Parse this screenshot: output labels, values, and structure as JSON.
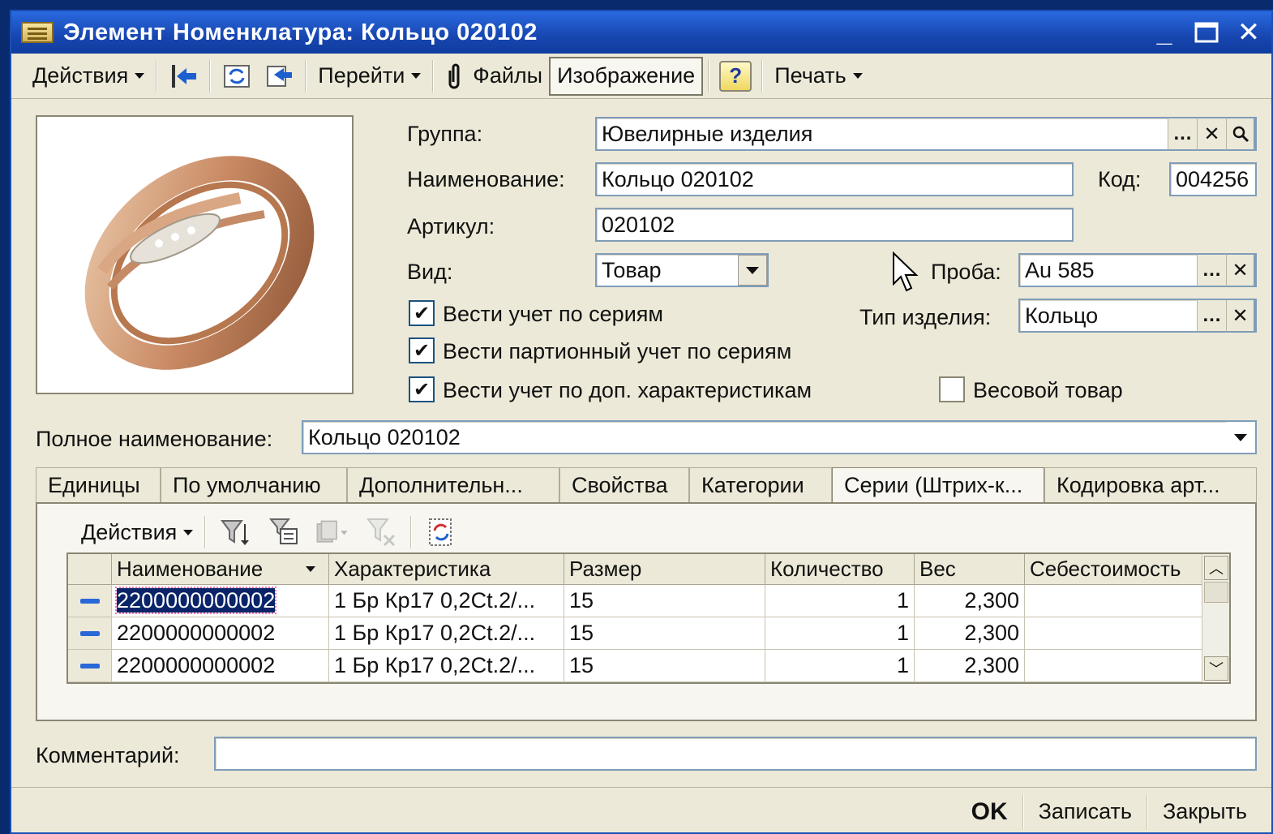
{
  "window": {
    "title": "Элемент Номенклатура: Кольцо 020102"
  },
  "toolbar": {
    "actions_label": "Действия",
    "goto_label": "Перейти",
    "files_label": "Файлы",
    "image_label": "Изображение",
    "help_label": "?",
    "print_label": "Печать"
  },
  "form": {
    "group_label": "Группа:",
    "group_value": "Ювелирные изделия",
    "name_label": "Наименование:",
    "name_value": "Кольцо 020102",
    "code_label": "Код:",
    "code_value": "004256",
    "article_label": "Артикул:",
    "article_value": "020102",
    "kind_label": "Вид:",
    "kind_value": "Товар",
    "probe_label": "Проба:",
    "probe_value": "Au 585",
    "product_type_label": "Тип изделия:",
    "product_type_value": "Кольцо",
    "check_series_label": "Вести учет по сериям",
    "check_series_checked": true,
    "check_batch_label": "Вести партионный учет по сериям",
    "check_batch_checked": true,
    "check_extra_label": "Вести учет по доп.  характеристикам",
    "check_extra_checked": true,
    "weight_label": "Весовой товар",
    "weight_checked": false,
    "full_name_label": "Полное наименование:",
    "full_name_value": "Кольцо 020102",
    "comment_label": "Комментарий:",
    "comment_value": ""
  },
  "tabs": [
    {
      "label": "Единицы",
      "active": false
    },
    {
      "label": "По умолчанию",
      "active": false
    },
    {
      "label": "Дополнительн...",
      "active": false
    },
    {
      "label": "Свойства",
      "active": false
    },
    {
      "label": "Категории",
      "active": false
    },
    {
      "label": "Серии (Штрих-к...",
      "active": true
    },
    {
      "label": "Кодировка арт...",
      "active": false
    }
  ],
  "panel": {
    "actions_label": "Действия"
  },
  "grid": {
    "columns": [
      "Наименование",
      "Характеристика",
      "Размер",
      "Количество",
      "Вес",
      "Себестоимость"
    ],
    "rows": [
      {
        "name": "2200000000002",
        "characteristic": "1 Бр Кр17 0,2Ct.2/...",
        "size": "15",
        "quantity": "1",
        "weight": "2,300",
        "cost": ""
      },
      {
        "name": "2200000000002",
        "characteristic": "1 Бр Кр17 0,2Ct.2/...",
        "size": "15",
        "quantity": "1",
        "weight": "2,300",
        "cost": ""
      },
      {
        "name": "2200000000002",
        "characteristic": "1 Бр Кр17 0,2Ct.2/...",
        "size": "15",
        "quantity": "1",
        "weight": "2,300",
        "cost": ""
      }
    ]
  },
  "bottom": {
    "ok_label": "OK",
    "save_label": "Записать",
    "close_label": "Закрыть"
  },
  "icons": {
    "title": "catalog-icon",
    "window_controls": [
      "minimize-icon",
      "maximize-icon",
      "close-icon"
    ],
    "toolbar": [
      "arrow-left-icon",
      "refresh-icon",
      "swap-icon",
      "paperclip-icon"
    ],
    "panel_toolbar": [
      "filter-icon",
      "filter-list-icon",
      "copy-icon",
      "clear-filter-icon",
      "refresh-icon"
    ]
  }
}
